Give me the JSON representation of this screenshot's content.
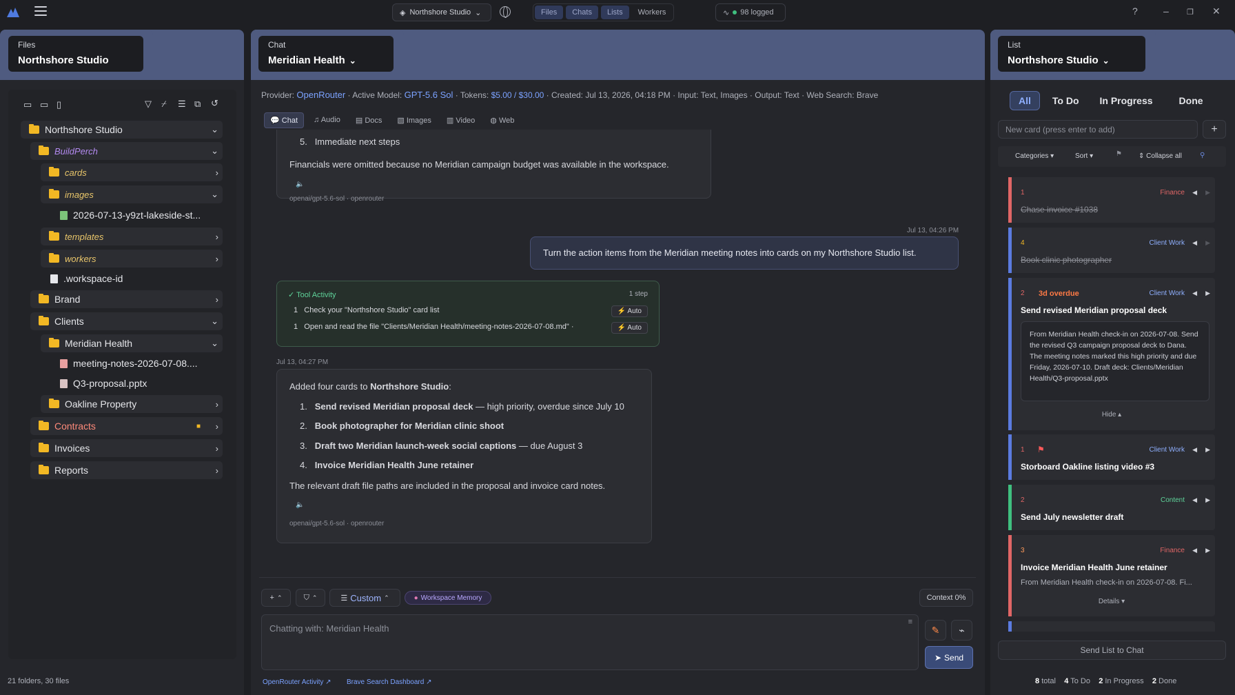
{
  "topbar": {
    "workspace": "Northshore Studio",
    "nav": [
      "Files",
      "Chats",
      "Lists",
      "Workers"
    ],
    "logged": "98 logged"
  },
  "files": {
    "tab_label": "Files",
    "workspace": "Northshore Studio",
    "footer": "21 folders, 30 files",
    "tree": [
      {
        "label": "Northshore Studio"
      },
      {
        "label": "BuildPerch"
      },
      {
        "label": "cards"
      },
      {
        "label": "images"
      },
      {
        "label": "2026-07-13-y9zt-lakeside-st..."
      },
      {
        "label": "templates"
      },
      {
        "label": "workers"
      },
      {
        "label": ".workspace-id"
      },
      {
        "label": "Brand"
      },
      {
        "label": "Clients"
      },
      {
        "label": "Meridian Health"
      },
      {
        "label": "meeting-notes-2026-07-08...."
      },
      {
        "label": "Q3-proposal.pptx"
      },
      {
        "label": "Oakline Property"
      },
      {
        "label": "Contracts"
      },
      {
        "label": "Invoices"
      },
      {
        "label": "Reports"
      }
    ]
  },
  "chat": {
    "tab_label": "Chat",
    "title": "Meridian Health",
    "meta": {
      "provider_k": "Provider:",
      "provider": "OpenRouter",
      "model_k": "Active Model:",
      "model": "GPT-5.6 Sol",
      "tokens_k": "Tokens:",
      "tokens": "$5.00 / $30.00",
      "created": "Created: Jul 13, 2026, 04:18 PM",
      "input": "Input: Text, Images",
      "output": "Output: Text",
      "search": "Web Search: Brave"
    },
    "modes": [
      "Chat",
      "Audio",
      "Docs",
      "Images",
      "Video",
      "Web"
    ],
    "msg1": {
      "item5": "Immediate next steps",
      "body": "Financials were omitted because no Meridian campaign budget was available in the workspace.",
      "src": "openai/gpt-5.6-sol · openrouter"
    },
    "user": {
      "time": "Jul 13, 04:26 PM",
      "text": "Turn the action items from the Meridian meeting notes into cards on my Northshore Studio list."
    },
    "tool": {
      "title": "✓ Tool Activity",
      "steps": "1 step",
      "s1": "Check your \"Northshore Studio\" card list",
      "s2": "Open and read the file \"Clients/Meridian Health/meeting-notes-2026-07-08.md\"",
      "auto": "Auto"
    },
    "msg2": {
      "time": "Jul 13, 04:27 PM",
      "intro_a": "Added four cards to ",
      "intro_b": "Northshore Studio",
      "intro_c": ":",
      "i1b": "Send revised Meridian proposal deck",
      "i1": " — high priority, overdue since July 10",
      "i2b": "Book photographer for Meridian clinic shoot",
      "i3b": "Draft two Meridian launch-week social captions",
      "i3": " — due August 3",
      "i4b": "Invoice Meridian Health June retainer",
      "outro": "The relevant draft file paths are included in the proposal and invoice card notes.",
      "src": "openai/gpt-5.6-sol · openrouter"
    },
    "composer": {
      "custom": "Custom",
      "memory": "Workspace Memory",
      "context": "Context 0%",
      "placeholder": "Chatting with: Meridian Health",
      "send": "Send"
    },
    "links": [
      "OpenRouter Activity",
      "Brave Search Dashboard"
    ]
  },
  "list": {
    "tab_label": "List",
    "title": "Northshore Studio",
    "filters": [
      "All",
      "To Do",
      "In Progress",
      "Done"
    ],
    "new_card": "New card (press enter to add)",
    "tools": {
      "categories": "Categories",
      "sort": "Sort",
      "collapse": "Collapse all"
    },
    "cards": [
      {
        "num": "1",
        "cat": "Finance",
        "title": "Chase invoice #1038"
      },
      {
        "num": "4",
        "cat": "Client Work",
        "title": "Book clinic photographer"
      },
      {
        "num": "2",
        "overdue": "3d overdue",
        "cat": "Client Work",
        "title": "Send revised Meridian proposal deck",
        "note": "From Meridian Health check-in on 2026-07-08. Send the revised Q3 campaign proposal deck to Dana. The meeting notes marked this high priority and due Friday, 2026-07-10. Draft deck: Clients/Meridian Health/Q3-proposal.pptx",
        "hide": "Hide ▴"
      },
      {
        "num": "1",
        "cat": "Client Work",
        "title": "Storboard Oakline listing video #3"
      },
      {
        "num": "2",
        "cat": "Content",
        "title": "Send July newsletter draft"
      },
      {
        "num": "3",
        "cat": "Finance",
        "title": "Invoice Meridian Health June retainer",
        "note": "From Meridian Health check-in on 2026-07-08. Fi...",
        "details": "Details ▾"
      }
    ],
    "send_list": "Send List to Chat",
    "stats": {
      "total_n": "8",
      "total": "total",
      "todo_n": "4",
      "todo": "To Do",
      "prog_n": "2",
      "prog": "In Progress",
      "done_n": "2",
      "done": "Done"
    }
  },
  "colors": {
    "accent": "#4f5b80",
    "finance": "#e06666",
    "client": "#5b7be0",
    "content": "#3fbf7f"
  }
}
